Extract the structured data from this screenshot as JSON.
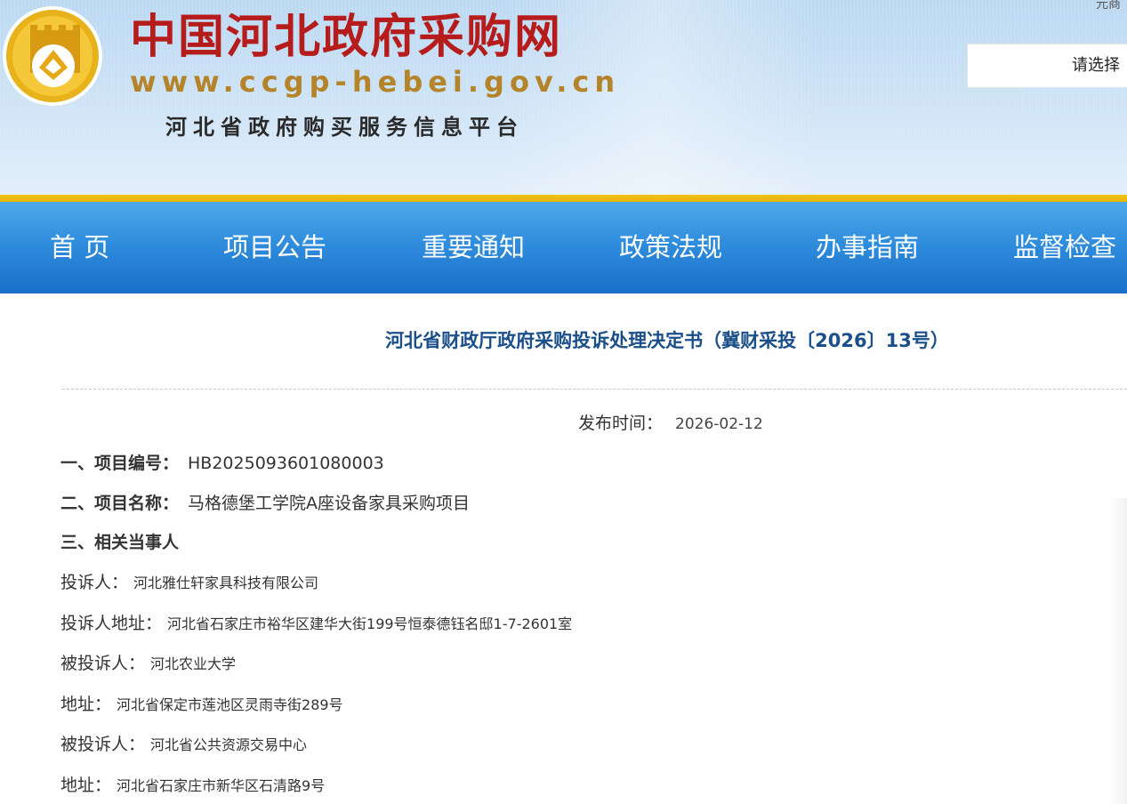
{
  "header": {
    "site_title": "中国河北政府采购网",
    "site_url": "www.ccgp-hebei.gov.cn",
    "site_subtitle": "河北省政府购买服务信息平台",
    "corner_text": "元商",
    "region_select": {
      "selected": "请选择"
    }
  },
  "nav": {
    "items": [
      {
        "label": "首 页"
      },
      {
        "label": "项目公告"
      },
      {
        "label": "重要通知"
      },
      {
        "label": "政策法规"
      },
      {
        "label": "办事指南"
      },
      {
        "label": "监督检查"
      }
    ]
  },
  "article": {
    "title": "河北省财政厅政府采购投诉处理决定书（冀财采投〔2026〕13号）",
    "publish_label": "发布时间：",
    "publish_date": "2026-02-12",
    "sections": [
      {
        "label": "一、项目编号：",
        "value": "HB2025093601080003"
      },
      {
        "label": "二、项目名称：",
        "value": "马格德堡工学院A座设备家具采购项目"
      },
      {
        "label": "三、相关当事人",
        "value": ""
      }
    ],
    "parties": [
      {
        "label": "投诉人：",
        "value": "河北雅仕轩家具科技有限公司"
      },
      {
        "label": "投诉人地址：",
        "value": "河北省石家庄市裕华区建华大街199号恒泰德钰名邸1-7-2601室"
      },
      {
        "label": "被投诉人：",
        "value": "河北农业大学"
      },
      {
        "label": "地址：",
        "value": "河北省保定市莲池区灵雨寺街289号"
      },
      {
        "label": "被投诉人：",
        "value": "河北省公共资源交易中心"
      },
      {
        "label": "地址：",
        "value": "河北省石家庄市新华区石清路9号"
      }
    ]
  },
  "colors": {
    "title_red": "#b71c1c",
    "url_gold": "#b5832a",
    "nav_blue": "#2f8ddd",
    "stripe_gold": "#f2c316",
    "article_title_blue": "#1a4f8a"
  }
}
